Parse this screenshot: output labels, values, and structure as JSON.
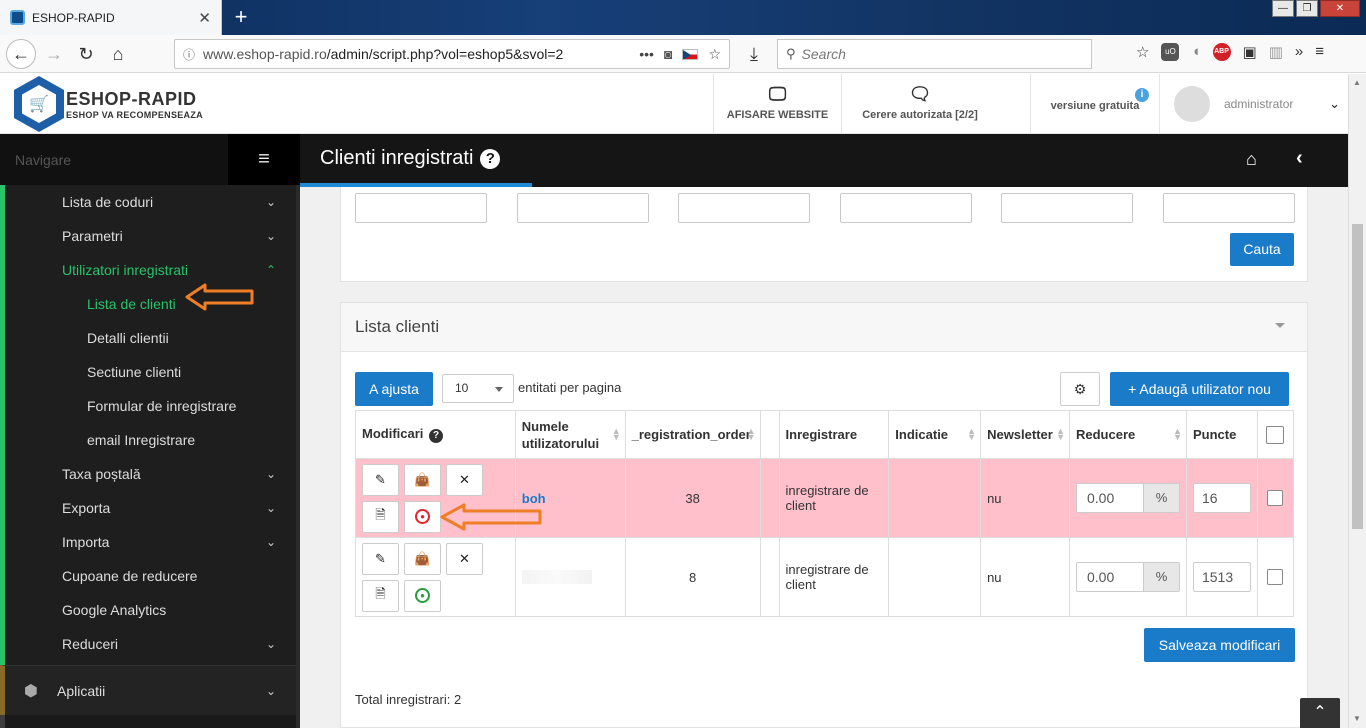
{
  "browser": {
    "tab_title": "ESHOP-RAPID",
    "url_host": "www.eshop-rapid.ro",
    "url_path": "/admin/script.php?vol=eshop5&svol=2",
    "search_placeholder": "Search",
    "abp_label": "ABP",
    "ublock_label": "uO"
  },
  "header": {
    "logo_title": "ESHOP-RAPID",
    "logo_subtitle": "ESHOP VA RECOMPENSEAZA",
    "website_label": "AFISARE WEBSITE",
    "requests_label": "Cerere autorizata [2/2]",
    "version_label": "versiune gratuita",
    "user_name": "administrator"
  },
  "sidebar": {
    "nav_title": "Navigare",
    "items": [
      {
        "label": "Lista de coduri",
        "chevron": "v"
      },
      {
        "label": "Parametri",
        "chevron": "v"
      },
      {
        "label": "Utilizatori inregistrati",
        "chevron": "^"
      },
      {
        "label": "Taxa poștală",
        "chevron": "v"
      },
      {
        "label": "Exporta",
        "chevron": "v"
      },
      {
        "label": "Importa",
        "chevron": "v"
      },
      {
        "label": "Cupoane de reducere",
        "chevron": ""
      },
      {
        "label": "Google Analytics",
        "chevron": ""
      },
      {
        "label": "Reduceri",
        "chevron": "v"
      }
    ],
    "subitems": [
      {
        "label": "Lista de clienti"
      },
      {
        "label": "Detalli clientii"
      },
      {
        "label": "Sectiune clienti"
      },
      {
        "label": "Formular de inregistrare"
      },
      {
        "label": "email Inregistrare"
      }
    ],
    "apps_label": "Aplicatii"
  },
  "page": {
    "title": "Clienti inregistrati",
    "search_button": "Cauta",
    "list_title": "Lista clienti",
    "adjust_button": "A ajusta",
    "per_page_value": "10",
    "per_page_label": "entitati per pagina",
    "add_user_button": "+ Adaugă utilizator nou",
    "save_button": "Salveaza modificari",
    "total_label": "Total inregistrari: 2"
  },
  "table": {
    "columns": [
      "Modificari",
      "Numele utilizatorului",
      "_registration_order",
      "",
      "Inregistrare",
      "Indicatie",
      "Newsletter",
      "Reducere",
      "Puncte"
    ],
    "rows": [
      {
        "username": "boh",
        "order": "38",
        "registration": "inregistrare de client",
        "indication": "",
        "newsletter": "nu",
        "discount": "0.00",
        "discount_unit": "%",
        "points": "16",
        "status_color": "#e0262c",
        "highlighted": true
      },
      {
        "username": "",
        "order": "8",
        "registration": "inregistrare de client",
        "indication": "",
        "newsletter": "nu",
        "discount": "0.00",
        "discount_unit": "%",
        "points": "1513",
        "status_color": "#2a9d3b",
        "highlighted": false
      }
    ]
  },
  "colors": {
    "accent_blue": "#1a7bc8",
    "sidebar_green": "#28c36b",
    "highlight_row": "#ffc0cb",
    "annotation_arrow": "#f07e26"
  }
}
